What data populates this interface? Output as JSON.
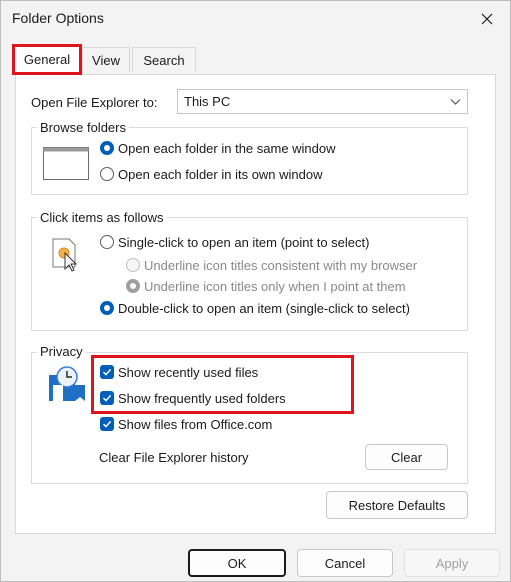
{
  "window": {
    "title": "Folder Options"
  },
  "tabs": [
    {
      "label": "General"
    },
    {
      "label": "View"
    },
    {
      "label": "Search"
    }
  ],
  "open_explorer": {
    "label": "Open File Explorer to:",
    "value": "This PC"
  },
  "browse_folders": {
    "title": "Browse folders",
    "options": [
      {
        "label": "Open each folder in the same window",
        "selected": true
      },
      {
        "label": "Open each folder in its own window",
        "selected": false
      }
    ]
  },
  "click_items": {
    "title": "Click items as follows",
    "options": [
      {
        "label": "Single-click to open an item (point to select)",
        "selected": false
      },
      {
        "label": "Underline icon titles consistent with my browser",
        "selected": false,
        "disabled": true
      },
      {
        "label": "Underline icon titles only when I point at them",
        "selected": true,
        "disabled": true
      },
      {
        "label": "Double-click to open an item (single-click to select)",
        "selected": true
      }
    ]
  },
  "privacy": {
    "title": "Privacy",
    "checks": [
      {
        "label": "Show recently used files",
        "checked": true
      },
      {
        "label": "Show frequently used folders",
        "checked": true
      },
      {
        "label": "Show files from Office.com",
        "checked": true
      }
    ],
    "clear_label": "Clear File Explorer history",
    "clear_button": "Clear"
  },
  "restore_defaults": "Restore Defaults",
  "footer": {
    "ok": "OK",
    "cancel": "Cancel",
    "apply": "Apply"
  },
  "colors": {
    "accent": "#005fb8",
    "highlight": "#e0141e"
  }
}
